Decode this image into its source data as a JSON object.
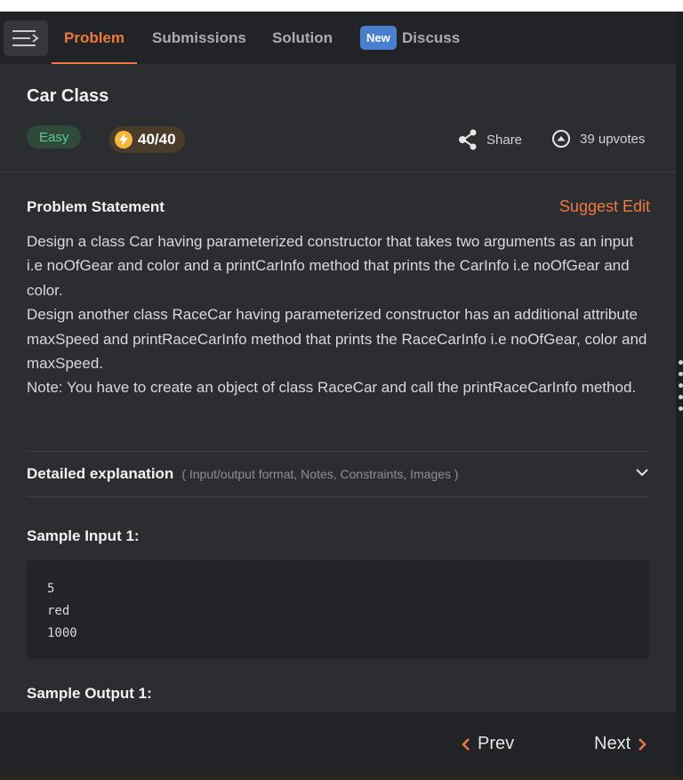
{
  "tabs": [
    {
      "label": "Problem",
      "active": true
    },
    {
      "label": "Submissions"
    },
    {
      "label": "Solution"
    },
    {
      "label": "Discuss",
      "badge": "New"
    }
  ],
  "problem": {
    "title": "Car Class",
    "difficulty": "Easy",
    "score": "40/40",
    "share_label": "Share",
    "upvotes": "39 upvotes"
  },
  "statement": {
    "heading": "Problem Statement",
    "suggest_edit": "Suggest Edit",
    "paragraphs": [
      "Design a class Car having parameterized constructor that takes two arguments as an input i.e noOfGear and color and a printCarInfo method that prints the CarInfo i.e noOfGear and color.",
      "Design another class RaceCar having parameterized constructor has an additional attribute maxSpeed and printRaceCarInfo method that prints the RaceCarInfo i.e noOfGear, color and maxSpeed.",
      "Note: You have to create an object of class RaceCar and call the printRaceCarInfo method."
    ]
  },
  "detailed": {
    "title": "Detailed explanation",
    "subtitle": "( Input/output format, Notes, Constraints, Images )"
  },
  "sample_input": {
    "title": "Sample Input 1:",
    "lines": "5\nred\n1000"
  },
  "sample_output": {
    "title": "Sample Output 1:"
  },
  "footer": {
    "prev": "Prev",
    "next": "Next"
  },
  "colors": {
    "accent": "#f0783e",
    "easy": "#5ec98a",
    "badge": "#4a7fd0"
  }
}
